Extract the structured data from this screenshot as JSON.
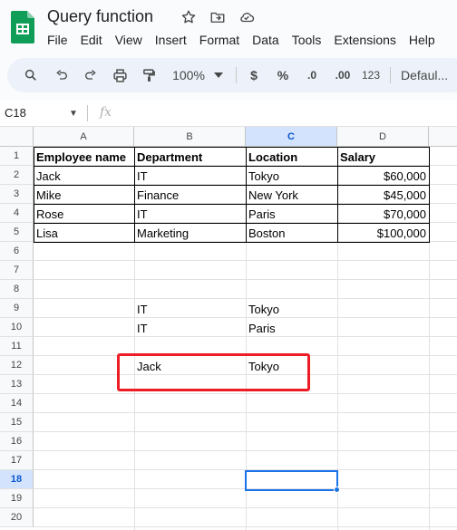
{
  "app": {
    "title": "Query function",
    "menu": [
      "File",
      "Edit",
      "View",
      "Insert",
      "Format",
      "Data",
      "Tools",
      "Extensions",
      "Help"
    ],
    "icons": [
      "star-icon",
      "move-to-folder-icon",
      "cloud-saved-icon"
    ]
  },
  "toolbar": {
    "zoom": "100%",
    "currency": "$",
    "percent": "%",
    "decrease_decimal": ".0",
    "increase_decimal": ".00",
    "number_format": "123",
    "font": "Defaul..."
  },
  "formula_bar": {
    "name_box": "C18",
    "fx": "fx",
    "value": ""
  },
  "sheet": {
    "columns": [
      "A",
      "B",
      "C",
      "D"
    ],
    "selected_column": "C",
    "selected_row": "18",
    "rows": [
      "1",
      "2",
      "3",
      "4",
      "5",
      "6",
      "7",
      "8",
      "9",
      "10",
      "11",
      "12",
      "13",
      "14",
      "15",
      "16",
      "17",
      "18",
      "19",
      "20"
    ],
    "table_header": [
      "Employee name",
      "Department",
      "Location",
      "Salary"
    ],
    "table_rows": [
      [
        "Jack",
        "IT",
        "Tokyo",
        "$60,000"
      ],
      [
        "Mike",
        "Finance",
        "New York",
        "$45,000"
      ],
      [
        "Rose",
        "IT",
        "Paris",
        "$70,000"
      ],
      [
        "Lisa",
        "Marketing",
        "Boston",
        "$100,000"
      ]
    ],
    "query_result_1": [
      [
        "IT",
        "Tokyo"
      ],
      [
        "IT",
        "Paris"
      ]
    ],
    "query_result_2": [
      "Jack",
      "Tokyo"
    ],
    "highlight_color": "#ee1c24",
    "selection_color": "#1a73e8"
  }
}
